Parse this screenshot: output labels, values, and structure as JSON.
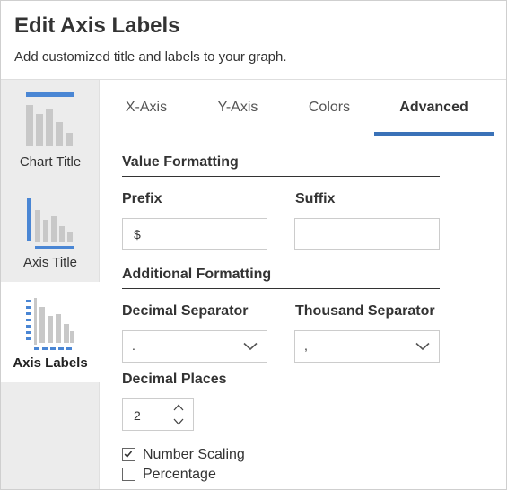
{
  "dialog": {
    "title": "Edit Axis Labels",
    "subtitle": "Add customized title and labels to your graph."
  },
  "sidebar": {
    "items": [
      {
        "label": "Chart Title",
        "icon": "chart-title-icon",
        "active": false
      },
      {
        "label": "Axis Title",
        "icon": "axis-title-icon",
        "active": false
      },
      {
        "label": "Axis Labels",
        "icon": "axis-labels-icon",
        "active": true
      }
    ]
  },
  "tabs": [
    {
      "label": "X-Axis",
      "active": false
    },
    {
      "label": "Y-Axis",
      "active": false
    },
    {
      "label": "Colors",
      "active": false
    },
    {
      "label": "Advanced",
      "active": true
    }
  ],
  "value_formatting": {
    "title": "Value Formatting",
    "prefix_label": "Prefix",
    "prefix_value": "$",
    "suffix_label": "Suffix",
    "suffix_value": ""
  },
  "additional_formatting": {
    "title": "Additional Formatting",
    "decimal_separator_label": "Decimal Separator",
    "decimal_separator_value": ".",
    "thousand_separator_label": "Thousand Separator",
    "thousand_separator_value": ",",
    "decimal_places_label": "Decimal Places",
    "decimal_places_value": "2"
  },
  "options": {
    "number_scaling_label": "Number Scaling",
    "number_scaling_checked": true,
    "percentage_label": "Percentage",
    "percentage_checked": false
  },
  "colors": {
    "accent": "#3a72b8",
    "icon_blue": "#4a86d4",
    "icon_gray": "#c8c8c8"
  }
}
